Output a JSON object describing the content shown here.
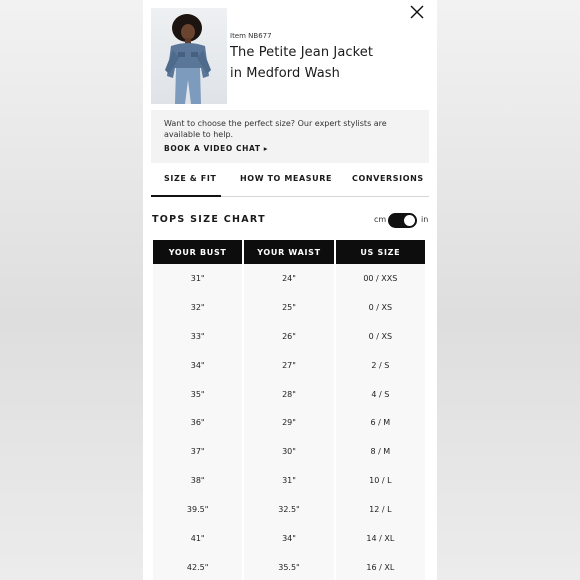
{
  "product": {
    "item_number": "Item NB677",
    "title_line1": "The Petite Jean Jacket",
    "title_line2": "in Medford Wash"
  },
  "stylist_banner": {
    "text": "Want to choose the perfect size? Our expert stylists are available to help.",
    "link_label": "BOOK A VIDEO CHAT ▸"
  },
  "tabs": [
    {
      "label": "SIZE & FIT",
      "active": true
    },
    {
      "label": "HOW TO MEASURE",
      "active": false
    },
    {
      "label": "CONVERSIONS",
      "active": false
    }
  ],
  "size_chart": {
    "title": "TOPS SIZE CHART",
    "unit_left": "cm",
    "unit_right": "in",
    "selected_unit": "in",
    "headers": [
      "YOUR BUST",
      "YOUR WAIST",
      "US SIZE"
    ],
    "rows": [
      [
        "31\"",
        "24\"",
        "00 / XXS"
      ],
      [
        "32\"",
        "25\"",
        "0 / XS"
      ],
      [
        "33\"",
        "26\"",
        "0 / XS"
      ],
      [
        "34\"",
        "27\"",
        "2 / S"
      ],
      [
        "35\"",
        "28\"",
        "4 / S"
      ],
      [
        "36\"",
        "29\"",
        "6 / M"
      ],
      [
        "37\"",
        "30\"",
        "8 / M"
      ],
      [
        "38\"",
        "31\"",
        "10 / L"
      ],
      [
        "39.5\"",
        "32.5\"",
        "12 / L"
      ],
      [
        "41\"",
        "34\"",
        "14 / XL"
      ],
      [
        "42.5\"",
        "35.5\"",
        "16 / XL"
      ]
    ]
  },
  "colors": {
    "header_bg": "#0d0d0d",
    "banner_bg": "#f3f3f3",
    "cell_bg": "#f8f8f8"
  },
  "icons": {
    "close": "close-icon",
    "product_image": "product-photo"
  }
}
